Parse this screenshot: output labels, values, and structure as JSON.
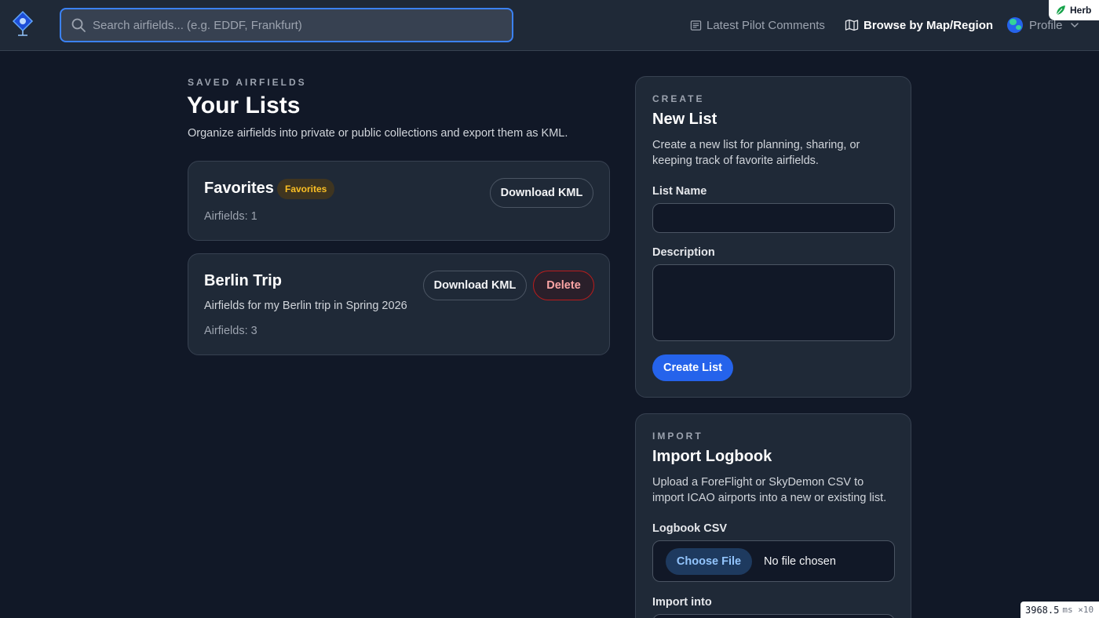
{
  "header": {
    "search_placeholder": "Search airfields... (e.g. EDDF, Frankfurt)",
    "search_value": "",
    "nav": {
      "comments_label": "Latest Pilot Comments",
      "map_label": "Browse by Map/Region",
      "profile_label": "Profile"
    },
    "herb_label": "Herb"
  },
  "lists_section": {
    "eyebrow": "SAVED AIRFIELDS",
    "title": "Your Lists",
    "description": "Organize airfields into private or public collections and export them as KML.",
    "lists": [
      {
        "name": "Favorites",
        "badge": "Favorites",
        "description": "",
        "count_text": "Airfields: 1",
        "download_label": "Download KML"
      },
      {
        "name": "Berlin Trip",
        "badge": "",
        "description": "Airfields for my Berlin trip in Spring 2026",
        "count_text": "Airfields: 3",
        "download_label": "Download KML",
        "delete_label": "Delete"
      }
    ]
  },
  "create_panel": {
    "eyebrow": "CREATE",
    "title": "New List",
    "description": "Create a new list for planning, sharing, or keeping track of favorite airfields.",
    "name_label": "List Name",
    "name_value": "",
    "description_label": "Description",
    "description_value": "",
    "submit_label": "Create List"
  },
  "import_panel": {
    "eyebrow": "IMPORT",
    "title": "Import Logbook",
    "description": "Upload a ForeFlight or SkyDemon CSV to import ICAO airports into a new or existing list.",
    "file_label": "Logbook CSV",
    "choose_file_label": "Choose File",
    "file_status": "No file chosen",
    "import_into_label": "Import into"
  },
  "perf_overlay": {
    "value": "3968.5",
    "unit": "ms ×10"
  },
  "colors": {
    "background": "#111827",
    "panel": "#1f2937",
    "accent": "#2563eb",
    "badge_text": "#fbbf24",
    "danger": "#b91c1c"
  },
  "icons": [
    "logo-icon",
    "search-icon",
    "comments-icon",
    "map-icon",
    "avatar",
    "chevron-down-icon",
    "leaf-icon"
  ]
}
